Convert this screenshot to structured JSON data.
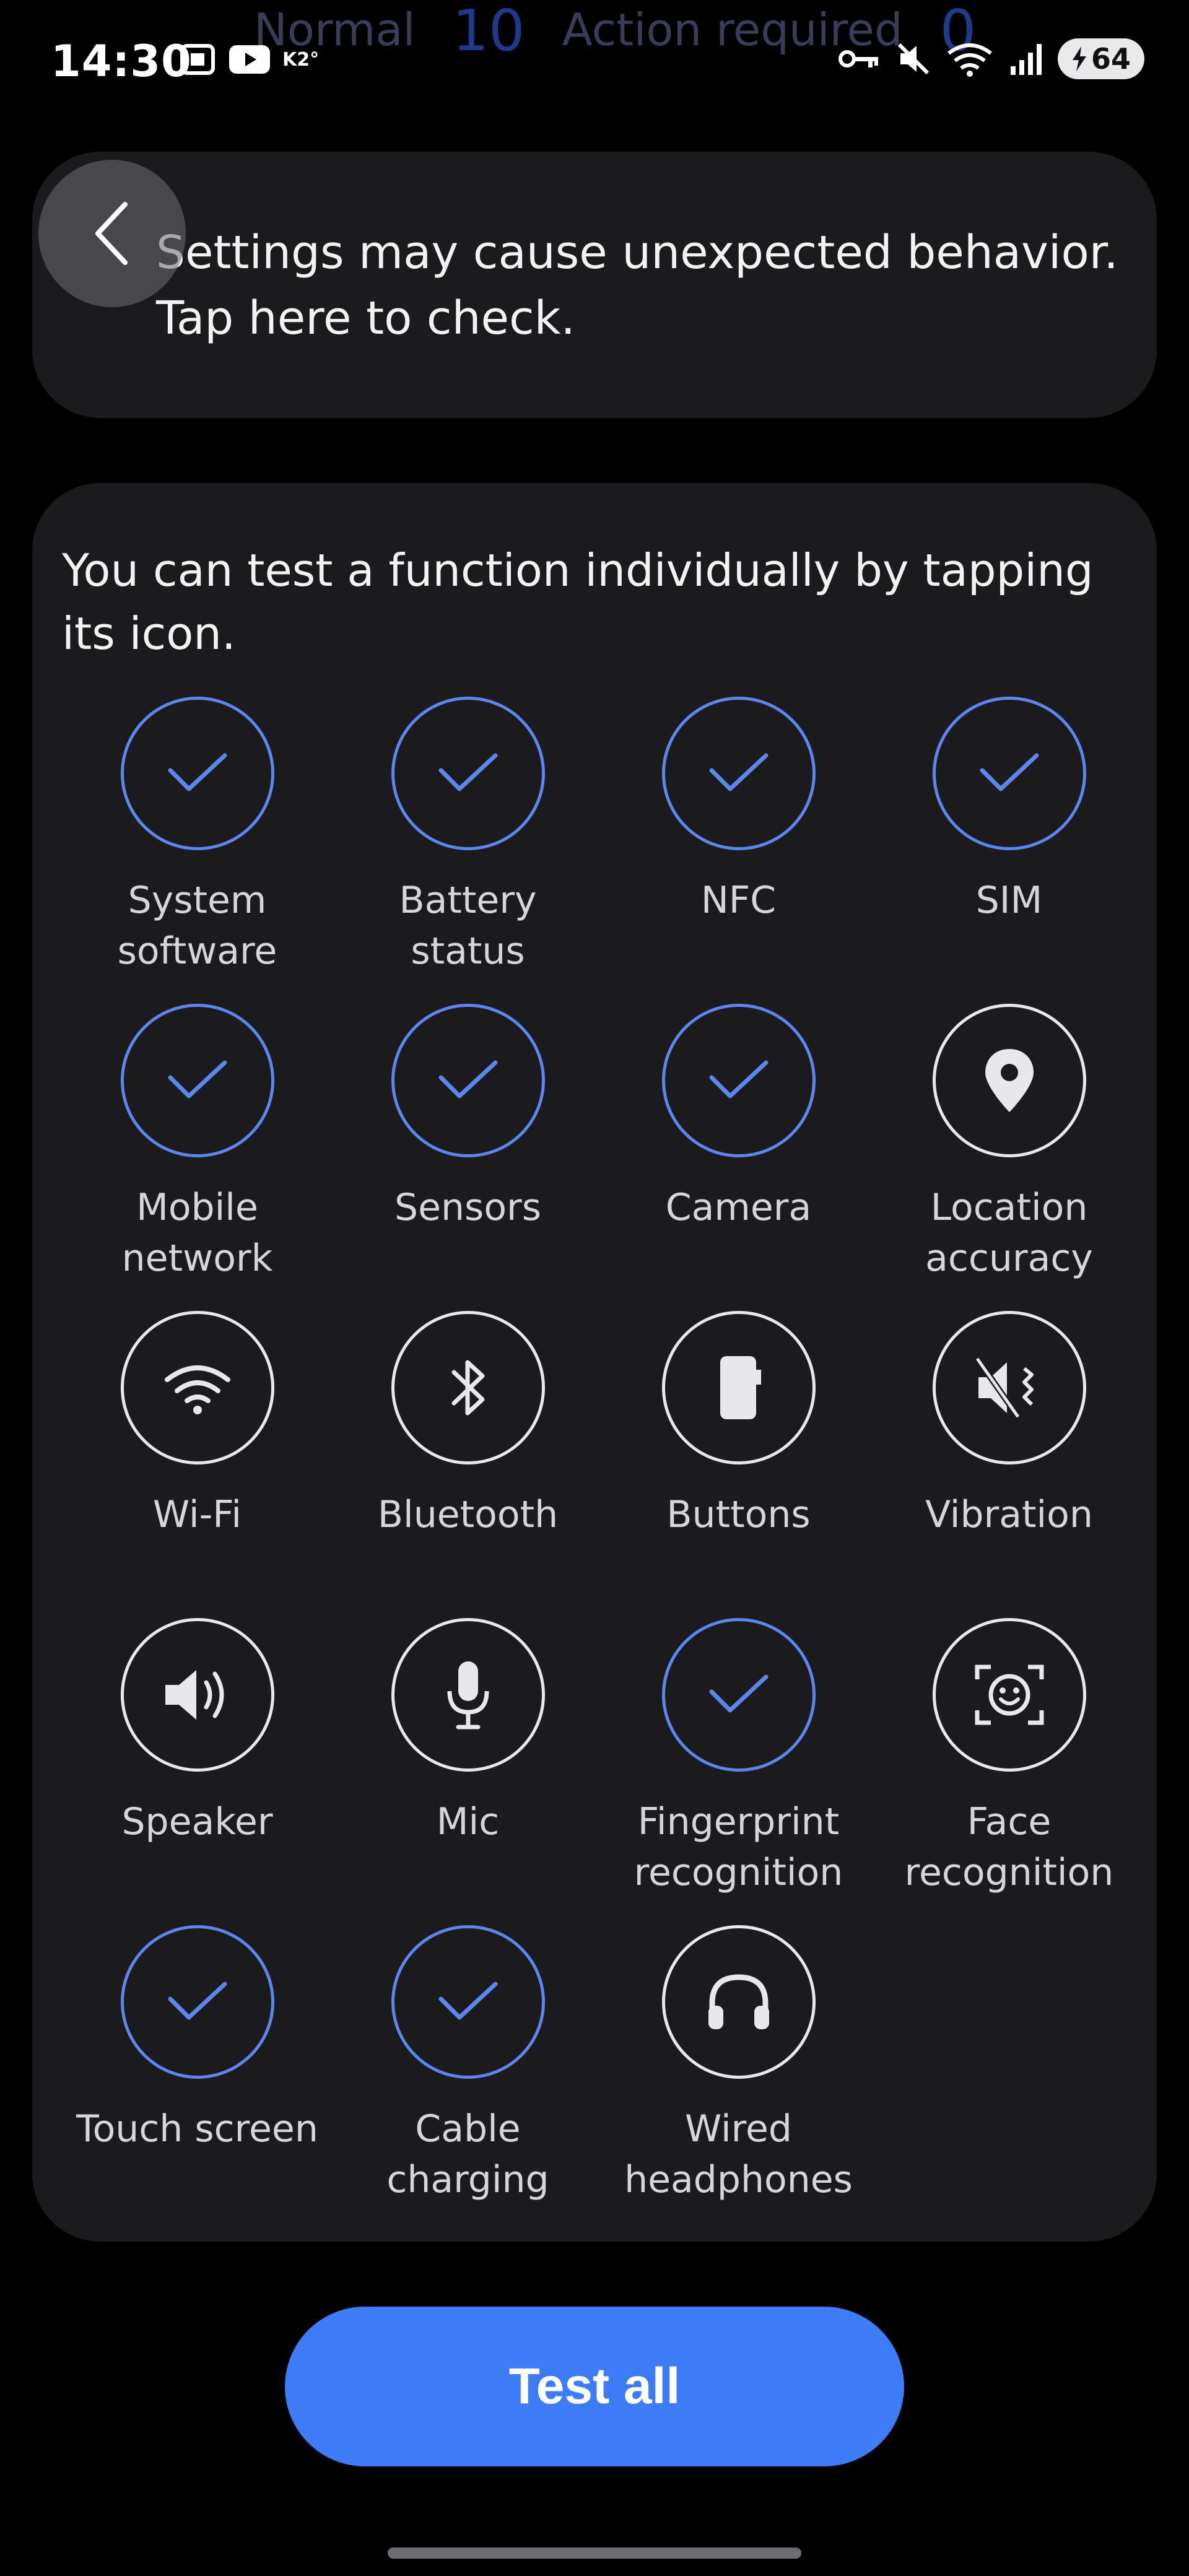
{
  "status_bar": {
    "time": "14:30",
    "battery": "64",
    "ghost_left_label": "Normal",
    "ghost_left_count": "10",
    "ghost_right_label": "Action required",
    "ghost_right_count": "0",
    "data_indicator": "K2°"
  },
  "warning": {
    "text": "Settings may cause unexpected behavior. Tap here to check."
  },
  "functions": {
    "intro": "You can test a function individually by tapping its icon.",
    "items": [
      {
        "label": "System\nsoftware",
        "icon": "check-icon",
        "status": "passed"
      },
      {
        "label": "Battery status",
        "icon": "check-icon",
        "status": "passed"
      },
      {
        "label": "NFC",
        "icon": "check-icon",
        "status": "passed"
      },
      {
        "label": "SIM",
        "icon": "check-icon",
        "status": "passed"
      },
      {
        "label": "Mobile\nnetwork",
        "icon": "check-icon",
        "status": "passed"
      },
      {
        "label": "Sensors",
        "icon": "check-icon",
        "status": "passed"
      },
      {
        "label": "Camera",
        "icon": "check-icon",
        "status": "passed"
      },
      {
        "label": "Location\naccuracy",
        "icon": "location-pin-icon",
        "status": "untested"
      },
      {
        "label": "Wi-Fi",
        "icon": "wifi-icon",
        "status": "untested"
      },
      {
        "label": "Bluetooth",
        "icon": "bluetooth-icon",
        "status": "untested"
      },
      {
        "label": "Buttons",
        "icon": "phone-buttons-icon",
        "status": "untested"
      },
      {
        "label": "Vibration",
        "icon": "vibration-icon",
        "status": "untested"
      },
      {
        "label": "Speaker",
        "icon": "speaker-icon",
        "status": "untested"
      },
      {
        "label": "Mic",
        "icon": "mic-icon",
        "status": "untested"
      },
      {
        "label": "Fingerprint\nrecognition",
        "icon": "check-icon",
        "status": "passed"
      },
      {
        "label": "Face\nrecognition",
        "icon": "face-scan-icon",
        "status": "untested"
      },
      {
        "label": "Touch screen",
        "icon": "check-icon",
        "status": "passed"
      },
      {
        "label": "Cable\ncharging",
        "icon": "check-icon",
        "status": "passed"
      },
      {
        "label": "Wired\nheadphones",
        "icon": "headphones-icon",
        "status": "untested"
      }
    ]
  },
  "actions": {
    "test_all": "Test all"
  },
  "colors": {
    "accent": "#3e7bf6",
    "passed_ring": "#5b86f0",
    "card_bg": "#1b1b1d"
  }
}
